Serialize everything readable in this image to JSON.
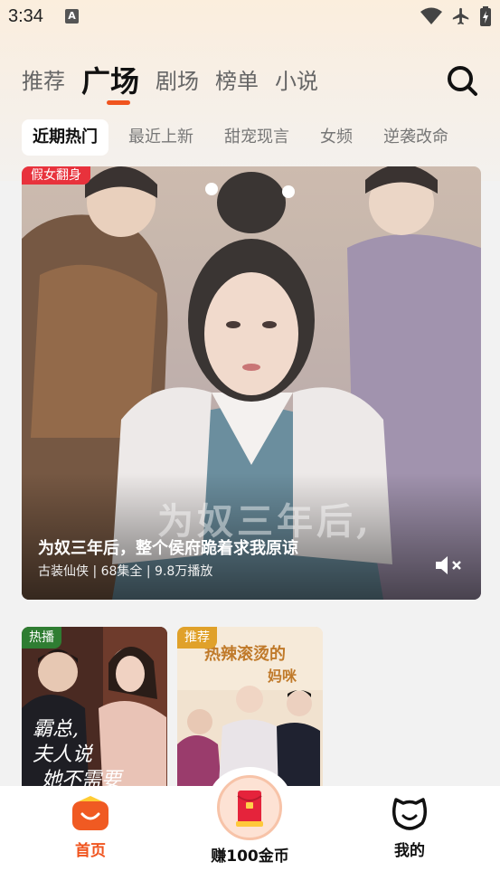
{
  "status_bar": {
    "time": "3:34",
    "a_icon_letter": "A"
  },
  "top_tabs": [
    {
      "label": "推荐",
      "active": false
    },
    {
      "label": "广场",
      "active": true
    },
    {
      "label": "剧场",
      "active": false
    },
    {
      "label": "榜单",
      "active": false
    },
    {
      "label": "小说",
      "active": false
    }
  ],
  "sub_tabs": [
    {
      "label": "近期热门",
      "active": true
    },
    {
      "label": "最近上新",
      "active": false
    },
    {
      "label": "甜宠现言",
      "active": false
    },
    {
      "label": "女频",
      "active": false
    },
    {
      "label": "逆袭改命",
      "active": false
    }
  ],
  "hero": {
    "badge": "假女翻身",
    "poster_text": "为奴三年后,",
    "title": "为奴三年后，整个侯府跪着求我原谅",
    "meta": "古装仙侠 | 68集全 | 9.8万播放"
  },
  "cards": [
    {
      "badge": "热播",
      "badge_color": "#2f7d32",
      "poster_text": "霸总，夫人说她不需要"
    },
    {
      "badge": "推荐",
      "badge_color": "#e0a12a",
      "poster_text": "热辣滚烫的妈咪"
    }
  ],
  "bottom_nav": {
    "home_label": "首页",
    "coins_label": "赚100金币",
    "mine_label": "我的"
  },
  "colors": {
    "accent": "#f0541e",
    "badge_red": "#e8323c"
  }
}
